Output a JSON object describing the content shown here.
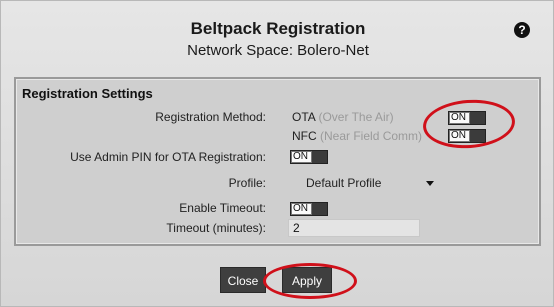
{
  "dialog": {
    "title": "Beltpack Registration",
    "subtitle": "Network Space: Bolero-Net",
    "help_icon": "help-circle-icon"
  },
  "panel": {
    "title": "Registration Settings",
    "registration_method_label": "Registration Method:",
    "ota": {
      "name": "OTA",
      "hint": "(Over The Air)",
      "toggle": "ON"
    },
    "nfc": {
      "name": "NFC",
      "hint": "(Near Field Comm)",
      "toggle": "ON"
    },
    "admin_pin_label": "Use Admin PIN for OTA Registration:",
    "admin_pin_toggle": "ON",
    "profile_label": "Profile:",
    "profile_value": "Default Profile",
    "enable_timeout_label": "Enable Timeout:",
    "enable_timeout_toggle": "ON",
    "timeout_label": "Timeout (minutes):",
    "timeout_value": "2"
  },
  "buttons": {
    "close": "Close",
    "apply": "Apply"
  },
  "colors": {
    "highlight": "#d0101a",
    "toggle_dark": "#3b3b3b",
    "button": "#3f3f3f"
  }
}
